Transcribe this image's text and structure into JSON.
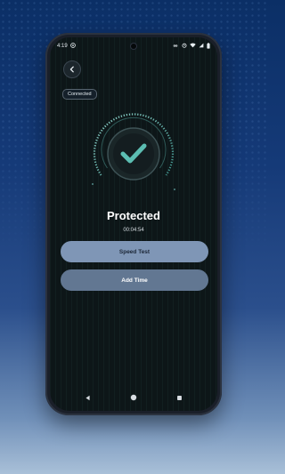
{
  "status_bar": {
    "time": "4:19",
    "extra_icon": "vpn-icon",
    "icons": [
      "infinity-icon",
      "alarm-icon",
      "wifi-icon",
      "signal-icon",
      "battery-icon"
    ]
  },
  "header": {
    "back_icon": "chevron-left-icon"
  },
  "connection": {
    "badge": "Connected"
  },
  "status": {
    "title": "Protected",
    "timer": "00:04:54",
    "icon": "checkmark-icon"
  },
  "buttons": {
    "speed_test": "Speed Test",
    "add_time": "Add Time"
  },
  "nav": {
    "icons": [
      "back-triangle-icon",
      "home-circle-icon",
      "recents-square-icon"
    ]
  },
  "colors": {
    "accent": "#59a7a0",
    "button_primary": "#7f96b6",
    "button_secondary": "#627792",
    "screen_bg": "#0d1618"
  }
}
